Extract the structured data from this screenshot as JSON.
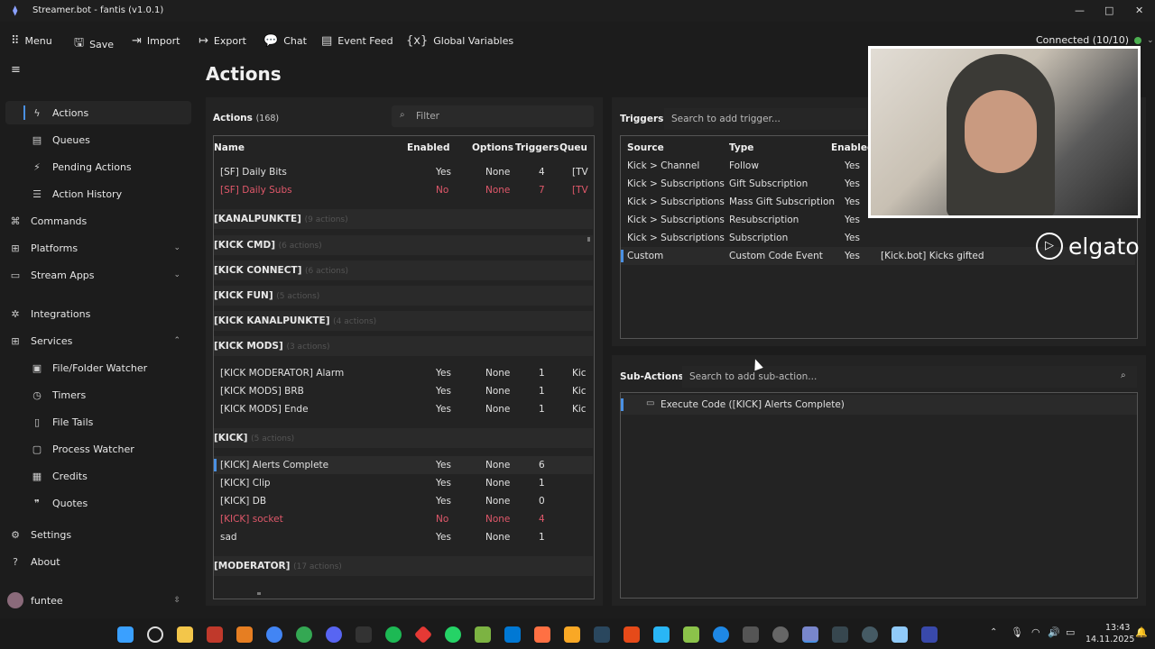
{
  "window": {
    "title": "Streamer.bot - fantis (v1.0.1)",
    "minimize": "—",
    "maximize": "□",
    "close": "✕"
  },
  "toolbar": {
    "menu": "Menu",
    "save": "Save",
    "import": "Import",
    "export": "Export",
    "chat": "Chat",
    "event_feed": "Event Feed",
    "global_variables": "Global Variables",
    "connection": "Connected (10/10)"
  },
  "sidebar": {
    "items": [
      {
        "label": "Actions",
        "icon": "lightning-icon"
      },
      {
        "label": "Queues",
        "icon": "queue-icon"
      },
      {
        "label": "Pending Actions",
        "icon": "wand-icon"
      },
      {
        "label": "Action History",
        "icon": "list-icon"
      },
      {
        "label": "Commands",
        "icon": "command-icon"
      },
      {
        "label": "Platforms",
        "icon": "platforms-icon"
      },
      {
        "label": "Stream Apps",
        "icon": "apps-icon"
      },
      {
        "label": "Integrations",
        "icon": "integrations-icon"
      },
      {
        "label": "Services",
        "icon": "grid-icon"
      },
      {
        "label": "File/Folder Watcher",
        "icon": "folder-icon"
      },
      {
        "label": "Timers",
        "icon": "timer-icon"
      },
      {
        "label": "File Tails",
        "icon": "file-icon"
      },
      {
        "label": "Process Watcher",
        "icon": "process-icon"
      },
      {
        "label": "Credits",
        "icon": "credits-icon"
      },
      {
        "label": "Quotes",
        "icon": "quote-icon"
      },
      {
        "label": "Settings",
        "icon": "gear-icon"
      },
      {
        "label": "About",
        "icon": "question-icon"
      }
    ],
    "user": "funtee"
  },
  "page": {
    "title": "Actions"
  },
  "actions": {
    "label": "Actions",
    "count": "(168)",
    "filter_placeholder": "Filter",
    "columns": [
      "Name",
      "Enabled",
      "Options",
      "Triggers",
      "Queue"
    ],
    "rows_top": [
      {
        "name": "[SF] Daily Bits",
        "enabled": "Yes",
        "options": "None",
        "triggers": "4",
        "queue": "[TV",
        "disabled": false
      },
      {
        "name": "[SF] Daily Subs",
        "enabled": "No",
        "options": "None",
        "triggers": "7",
        "queue": "[TV",
        "disabled": true
      }
    ],
    "groups": [
      {
        "name": "[KANALPUNKTE]",
        "count": "(9 actions)"
      },
      {
        "name": "[KICK CMD]",
        "count": "(6 actions)"
      },
      {
        "name": "[KICK CONNECT]",
        "count": "(6 actions)"
      },
      {
        "name": "[KICK FUN]",
        "count": "(5 actions)"
      },
      {
        "name": "[KICK KANALPUNKTE]",
        "count": "(4 actions)"
      },
      {
        "name": "[KICK MODS]",
        "count": "(3 actions)"
      },
      {
        "name": "[KICK]",
        "count": "(5 actions)"
      },
      {
        "name": "[MODERATOR]",
        "count": "(17 actions)"
      }
    ],
    "rows_mods": [
      {
        "name": "[KICK MODERATOR] Alarm",
        "enabled": "Yes",
        "options": "None",
        "triggers": "1",
        "queue": "Kic"
      },
      {
        "name": "[KICK MODS] BRB",
        "enabled": "Yes",
        "options": "None",
        "triggers": "1",
        "queue": "Kic"
      },
      {
        "name": "[KICK MODS] Ende",
        "enabled": "Yes",
        "options": "None",
        "triggers": "1",
        "queue": "Kic"
      }
    ],
    "rows_kick": [
      {
        "name": "[KICK] Alerts Complete",
        "enabled": "Yes",
        "options": "None",
        "triggers": "6",
        "disabled": false
      },
      {
        "name": "[KICK] Clip",
        "enabled": "Yes",
        "options": "None",
        "triggers": "1",
        "disabled": false
      },
      {
        "name": "[KICK] DB",
        "enabled": "Yes",
        "options": "None",
        "triggers": "0",
        "disabled": false
      },
      {
        "name": "[KICK] socket",
        "enabled": "No",
        "options": "None",
        "triggers": "4",
        "disabled": true
      },
      {
        "name": "sad",
        "enabled": "Yes",
        "options": "None",
        "triggers": "1",
        "disabled": false
      }
    ]
  },
  "triggers": {
    "label": "Triggers",
    "search_placeholder": "Search to add trigger...",
    "columns": [
      "Source",
      "Type",
      "Enabled"
    ],
    "rows": [
      {
        "source": "Kick > Channel",
        "type": "Follow",
        "enabled": "Yes",
        "extra": ""
      },
      {
        "source": "Kick > Subscriptions",
        "type": "Gift Subscription",
        "enabled": "Yes",
        "extra": ""
      },
      {
        "source": "Kick > Subscriptions",
        "type": "Mass Gift Subscription",
        "enabled": "Yes",
        "extra": ""
      },
      {
        "source": "Kick > Subscriptions",
        "type": "Resubscription",
        "enabled": "Yes",
        "extra": ""
      },
      {
        "source": "Kick > Subscriptions",
        "type": "Subscription",
        "enabled": "Yes",
        "extra": ""
      },
      {
        "source": "Custom",
        "type": "Custom Code Event",
        "enabled": "Yes",
        "extra": "[Kick.bot] Kicks gifted"
      }
    ]
  },
  "subactions": {
    "label": "Sub-Actions",
    "search_placeholder": "Search to add sub-action...",
    "items": [
      "Execute Code ([KICK] Alerts Complete)"
    ]
  },
  "overlay": {
    "brand": "elgato"
  },
  "taskbar": {
    "time": "13:43",
    "date": "14.11.2025"
  }
}
